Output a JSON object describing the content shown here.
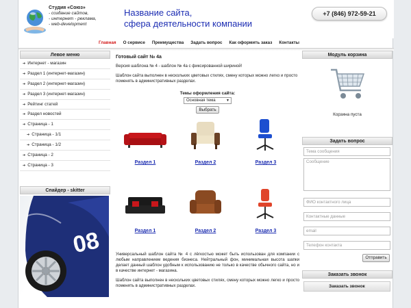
{
  "header": {
    "studio": "Студия «Союз»",
    "tagline": [
      "- создание сайтов,",
      "- интернет - реклама,",
      "- web-development"
    ],
    "site_title_1": "Название сайта,",
    "site_title_2": "сфера деятельности компании",
    "phone": "+7 (846) 972-59-21"
  },
  "nav": [
    "Главная",
    "О сервисе",
    "Преимущества",
    "Задать вопрос",
    "Как оформить заказ",
    "Контакты"
  ],
  "left": {
    "menu_title": "Левое меню",
    "menu": [
      {
        "label": "Интернет - магазин",
        "sub": false
      },
      {
        "label": "Раздел 1 (интернет-магазин)",
        "sub": false
      },
      {
        "label": "Раздел 2 (интернет-магазин)",
        "sub": false
      },
      {
        "label": "Раздел 3 (интернет-магазин)",
        "sub": false
      },
      {
        "label": "Рейтинг статей",
        "sub": false
      },
      {
        "label": "Раздел новостей",
        "sub": false
      },
      {
        "label": "Страница - 1",
        "sub": false
      },
      {
        "label": "Страница - 1/1",
        "sub": true
      },
      {
        "label": "Страница - 1/2",
        "sub": true
      },
      {
        "label": "Страница - 2",
        "sub": false
      },
      {
        "label": "Страница - 3",
        "sub": false
      }
    ],
    "slider_title": "Спайдер - skitter"
  },
  "center": {
    "title": "Готовый сайт № 4а",
    "p1": "Версия шаблона № 4 - шаблон № 4а с фиксированной шириной!",
    "p2": "Шаблон сайта выполнен в нескольких цветовых стилях, смену которых можно легко и просто поменять в административных разделах.",
    "theme_label": "Темы оформления сайта:",
    "theme_value": "Основная тема",
    "choose_button": "Выбрать",
    "items": [
      "Раздел 1",
      "Раздел 2",
      "Раздел 3",
      "Раздел 1",
      "Раздел 2",
      "Раздел 3"
    ],
    "p3": "Универсальный шаблон сайта № 4 с лёгкостью может быть использован для компании с любым направлением ведения бизнеса. Нейтральный фон, минимальная высота шапки делает данный шаблон удобным к использованию не только в качестве обычного сайта, но и в качестве интернет - магазина.",
    "p4": "Шаблон сайта выполнен в нескольких цветовых стилях, смену которых можно легко и просто поменять в административных разделах."
  },
  "right": {
    "cart_title": "Модуль корзина",
    "cart_empty": "Корзина пуста",
    "question_title": "Задать вопрос",
    "subject_placeholder": "Тема сообщения",
    "message_placeholder": "Сообщение",
    "name_placeholder": "ФИО контактного лица",
    "contacts_placeholder": "Контактные данные",
    "email_placeholder": "email",
    "phone_placeholder": "Телефон контакта",
    "send_button": "Отправить",
    "call_title": "Заказать звонок",
    "call_button": "Заказать звонок"
  },
  "colors": {
    "accent_red": "#d31a1a",
    "title_blue": "#1d2eb3",
    "link_blue": "#1a2bb0"
  }
}
